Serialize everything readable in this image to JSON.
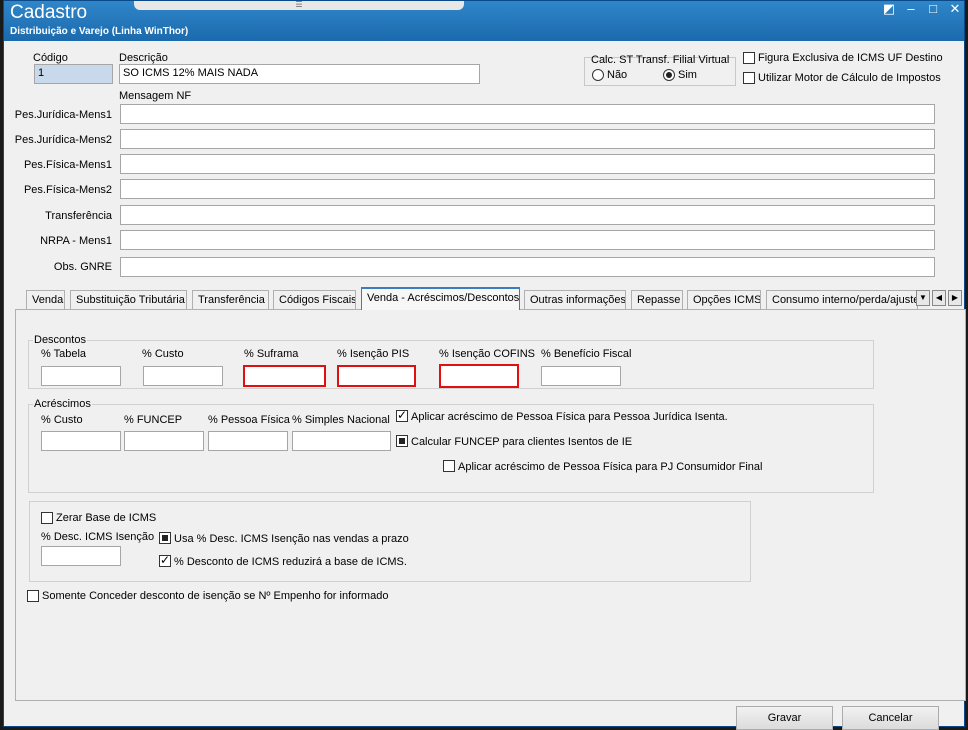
{
  "window": {
    "title": "Cadastro",
    "subtitle": "Distribuição e Varejo (Linha WinThor)"
  },
  "header": {
    "codigo_label": "Código",
    "codigo_value": "1",
    "descricao_label": "Descrição",
    "descricao_value": "SO ICMS 12% MAIS NADA",
    "calc_st_label": "Calc. ST Transf. Filial Virtual",
    "radio_nao": "Não",
    "radio_sim": "Sim",
    "figura_label": "Figura Exclusiva de ICMS UF Destino",
    "motor_label": "Utilizar Motor de Cálculo de Impostos",
    "mensagem_label": "Mensagem NF"
  },
  "messages": [
    {
      "label": "Pes.Jurídica-Mens1",
      "value": ""
    },
    {
      "label": "Pes.Jurídica-Mens2",
      "value": ""
    },
    {
      "label": "Pes.Física-Mens1",
      "value": ""
    },
    {
      "label": "Pes.Física-Mens2",
      "value": ""
    },
    {
      "label": "Transferência",
      "value": ""
    },
    {
      "label": "NRPA - Mens1",
      "value": ""
    },
    {
      "label": "Obs. GNRE",
      "value": ""
    }
  ],
  "tabs": [
    "Venda",
    "Substituição Tributária",
    "Transferência",
    "Códigos Fiscais",
    "Venda - Acréscimos/Descontos",
    "Outras informações",
    "Repasse",
    "Opções ICMS",
    "Consumo interno/perda/ajuste"
  ],
  "descontos": {
    "title": "Descontos",
    "tabela": "% Tabela",
    "custo": "% Custo",
    "suframa": "% Suframa",
    "isencao_pis": "% Isenção PIS",
    "isencao_cofins": "% Isenção COFINS",
    "beneficio": "% Benefício Fiscal"
  },
  "acrescimos": {
    "title": "Acréscimos",
    "custo": "% Custo",
    "funcep": "% FUNCEP",
    "pessoa_fisica": "% Pessoa Física",
    "simples": "% Simples Nacional",
    "chk_aplicar_pj": "Aplicar acréscimo de Pessoa Física para Pessoa Jurídica Isenta.",
    "chk_funcep": "Calcular FUNCEP para clientes Isentos de IE",
    "chk_pj_consumidor": "Aplicar acréscimo de Pessoa Física para PJ Consumidor Final"
  },
  "icms": {
    "zerar": "Zerar Base de ICMS",
    "desc_isencao": "% Desc. ICMS Isenção",
    "usa_desc": "Usa % Desc. ICMS Isenção nas vendas a prazo",
    "reduzira": "% Desconto de ICMS reduzirá a base de ICMS."
  },
  "empenho": "Somente Conceder desconto de isenção se Nº Empenho for informado",
  "buttons": {
    "gravar": "Gravar",
    "cancelar": "Cancelar"
  },
  "icons": [
    "restore-icon",
    "minimize-icon",
    "maximize-icon",
    "close-icon",
    "tab-dropdown-icon",
    "tab-prev-icon",
    "tab-next-icon"
  ]
}
